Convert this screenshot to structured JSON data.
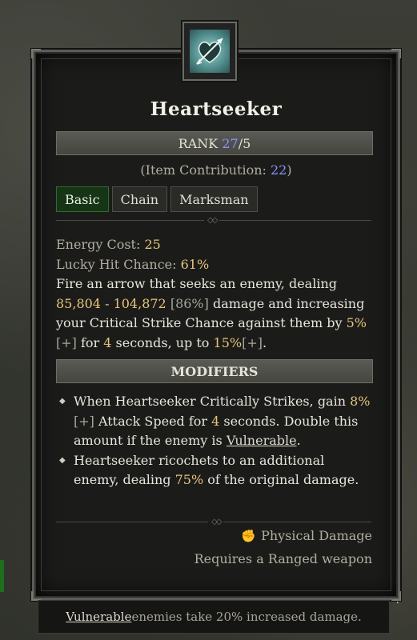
{
  "skill": {
    "name": "Heartseeker",
    "rank_label": "RANK",
    "rank_current": "27",
    "rank_sep": "/",
    "rank_max": "5",
    "contribution_prefix": "(Item Contribution: ",
    "contribution_value": "22",
    "contribution_suffix": ")",
    "tags": [
      "Basic",
      "Chain",
      "Marksman"
    ],
    "icon": "heart-arrow-icon"
  },
  "stats": {
    "energy_label": "Energy Cost: ",
    "energy_value": "25",
    "lucky_label": "Lucky Hit Chance: ",
    "lucky_value": "61%",
    "desc_1": "Fire an arrow that seeks an enemy, dealing",
    "damage_range": "85,804 - 104,872",
    "damage_pct": "[86%]",
    "desc_2": " damage and increasing",
    "desc_3": "your Critical Strike Chance against them by ",
    "crit_pct": "5%",
    "plus_1": "[+]",
    "desc_4": " for ",
    "seconds": "4",
    "desc_5": " seconds, up to ",
    "max_pct": "15%",
    "plus_2": "[+]",
    "desc_6": "."
  },
  "modifiers": {
    "header": "MODIFIERS",
    "m1_a": "When ",
    "m1_name": "Heartseeker",
    "m1_b": " Critically Strikes, gain ",
    "m1_pct": "8%",
    "m1_plus": "[+]",
    "m1_c": " Attack Speed for ",
    "m1_secs": "4",
    "m1_d": " seconds. Double this amount if the enemy is ",
    "m1_vuln": "Vulnerable",
    "m1_e": ".",
    "m2_name": "Heartseeker",
    "m2_a": " ricochets to an additional enemy, dealing ",
    "m2_pct": "75%",
    "m2_b": " of the original damage."
  },
  "footer": {
    "damage_type": "Physical Damage",
    "damage_type_icon": "fist-icon",
    "requirement": "Requires a Ranged weapon"
  },
  "tip": {
    "keyword": "Vulnerable",
    "text": " enemies take 20% increased damage."
  },
  "edge": {
    "number": "4"
  }
}
